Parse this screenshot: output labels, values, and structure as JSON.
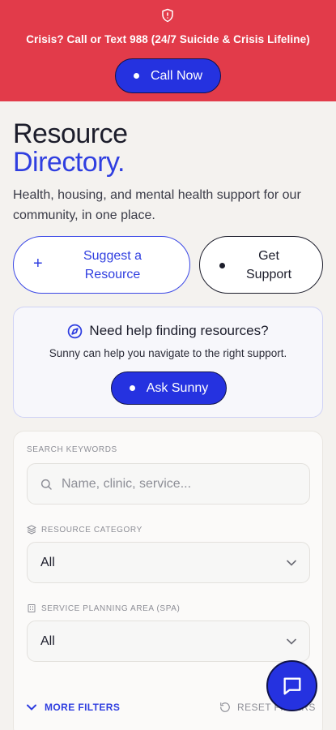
{
  "colors": {
    "banner": "#e23b4a",
    "accent": "#2f3ee0",
    "button": "#2532e0"
  },
  "banner": {
    "icon": "shield-alert-icon",
    "crisis_text": "Crisis? Call or Text 988 (24/7 Suicide & Crisis Lifeline)",
    "call_label": "Call Now"
  },
  "hero": {
    "title_line1": "Resource",
    "title_line2": "Directory.",
    "subtitle": "Health, housing, and mental health support for our community, in one place."
  },
  "actions": {
    "suggest_label": "Suggest a Resource",
    "support_label": "Get Support"
  },
  "help": {
    "icon": "compass-icon",
    "heading": "Need help finding resources?",
    "description": "Sunny can help you navigate to the right support.",
    "ask_label": "Ask Sunny"
  },
  "filters": {
    "search_label": "SEARCH KEYWORDS",
    "search_placeholder": "Name, clinic, service...",
    "search_value": "",
    "category_label": "RESOURCE CATEGORY",
    "category_value": "All",
    "spa_label": "SERVICE PLANNING AREA (SPA)",
    "spa_value": "All",
    "more_filters_label": "MORE FILTERS",
    "reset_label": "RESET FILTERS"
  },
  "chat": {
    "icon": "chat-bubble-icon"
  }
}
